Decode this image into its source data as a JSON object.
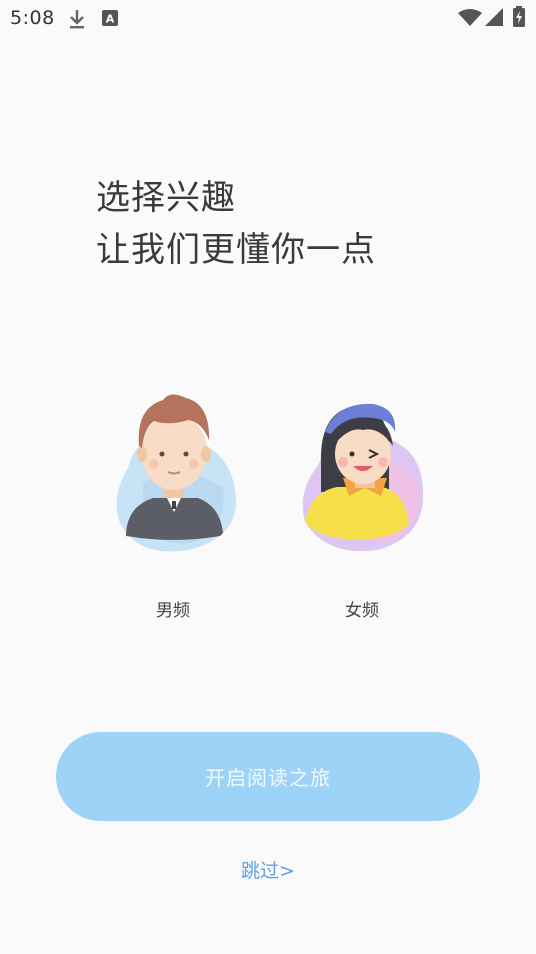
{
  "status_bar": {
    "time": "5:08",
    "icons": [
      "download-icon",
      "app-a-icon",
      "wifi-icon",
      "signal-icon",
      "battery-charging-icon"
    ]
  },
  "heading": {
    "line1": "选择兴趣",
    "line2": "让我们更懂你一点"
  },
  "options": [
    {
      "label": "男频",
      "icon": "male-avatar-icon"
    },
    {
      "label": "女频",
      "icon": "female-avatar-icon"
    }
  ],
  "start_button": {
    "label": "开启阅读之旅"
  },
  "skip": {
    "label": "跳过>"
  },
  "colors": {
    "button": "#9dd3f7",
    "link": "#5ba3e6",
    "background": "#fafafa"
  }
}
